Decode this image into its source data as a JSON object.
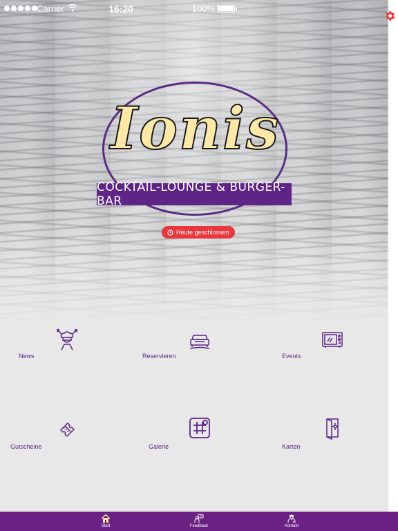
{
  "status_bar": {
    "carrier": "Carrier",
    "time": "16:20",
    "battery": "100%"
  },
  "logo": {
    "word": "Ionis",
    "banner": "COCKTAIL-LOUNGE & BURGER-BAR"
  },
  "status": {
    "label": "Heute geschlossen",
    "icon": "clock-icon",
    "color": "#e8383d"
  },
  "menu": [
    {
      "label": "News",
      "icon": "chef-icon"
    },
    {
      "label": "Reservieren",
      "icon": "reserved-table-icon"
    },
    {
      "label": "Events",
      "icon": "tv-screen-icon"
    },
    {
      "label": "Gutscheine",
      "icon": "ticket-icon"
    },
    {
      "label": "Galerie",
      "icon": "gallery-grid-icon"
    },
    {
      "label": "Karten",
      "icon": "menu-card-icon"
    }
  ],
  "tabs": [
    {
      "label": "Start",
      "icon": "home-icon"
    },
    {
      "label": "Feedback",
      "icon": "feedback-icon"
    },
    {
      "label": "Kontakt",
      "icon": "contact-person-icon"
    }
  ],
  "colors": {
    "brand_purple": "#6a2183",
    "logo_cream": "#fde8a8",
    "settings_red": "#e8383d"
  }
}
